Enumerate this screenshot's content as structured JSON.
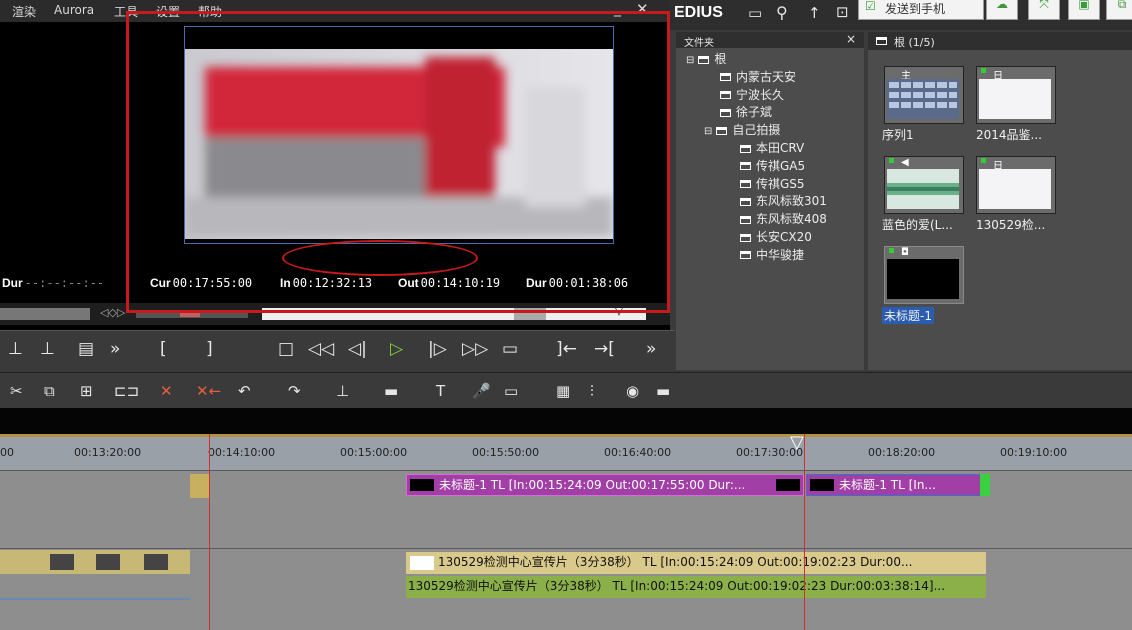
{
  "menu": [
    "渲染",
    "Aurora",
    "工具",
    "设置",
    "帮助"
  ],
  "player": {
    "dur_left_label": "Dur",
    "dur_left_value": "--:--:--:--",
    "cur_label": "Cur",
    "cur_value": "00:17:55:00",
    "in_label": "In",
    "in_value": "00:12:32:13",
    "out_label": "Out",
    "out_value": "00:14:10:19",
    "dur_label": "Dur",
    "dur_value": "00:01:38:06"
  },
  "edius": {
    "title": "EDIUS",
    "send_to_phone": "发送到手机"
  },
  "folder_panel": {
    "title": "文件夹",
    "close": "×",
    "tree": [
      {
        "label": "根",
        "level": 0,
        "expander": "⊟"
      },
      {
        "label": "内蒙古天安",
        "level": 1
      },
      {
        "label": "宁波长久",
        "level": 1
      },
      {
        "label": "徐子斌",
        "level": 1
      },
      {
        "label": "自己拍摄",
        "level": 1,
        "expander": "⊟"
      },
      {
        "label": "本田CRV",
        "level": 2
      },
      {
        "label": "传祺GA5",
        "level": 2
      },
      {
        "label": "传祺GS5",
        "level": 2
      },
      {
        "label": "东风标致301",
        "level": 2
      },
      {
        "label": "东风标致408",
        "level": 2
      },
      {
        "label": "长安CX20",
        "level": 2
      },
      {
        "label": "中华骏捷",
        "level": 2
      }
    ]
  },
  "bin": {
    "title": "根 (1/5)",
    "clips": [
      {
        "label": "序列1",
        "badge": "主"
      },
      {
        "label": "2014品鉴...",
        "badge": "日"
      },
      {
        "label": "蓝色的爱(L...",
        "badge": "◀"
      },
      {
        "label": "130529检...",
        "badge": "日"
      },
      {
        "label": "未标题-1",
        "badge": "◘"
      }
    ]
  },
  "timeline": {
    "ruler": [
      "00",
      "00:13:20:00",
      "00:14:10:00",
      "00:15:00:00",
      "00:15:50:00",
      "00:16:40:00",
      "00:17:30:00",
      "00:18:20:00",
      "00:19:10:00"
    ],
    "video_clip_1": "未标题-1  TL [In:00:15:24:09 Out:00:17:55:00 Dur:...",
    "video_clip_2": "未标题-1  TL [In...",
    "audio_clip_1": "130529检测中心宣传片（3分38秒）  TL [In:00:15:24:09 Out:00:19:02:23 Dur:00...",
    "audio_clip_2": "130529检测中心宣传片（3分38秒）  TL [In:00:15:24:09 Out:00:19:02:23 Dur:00:03:38:14]..."
  },
  "colors": {
    "annotation": "#c81a1a",
    "video_clip": "#a13fa6",
    "audio_clip_top": "#d9c98a",
    "audio_clip_bottom": "#8bb04a",
    "selected_label": "#2a5db0"
  }
}
